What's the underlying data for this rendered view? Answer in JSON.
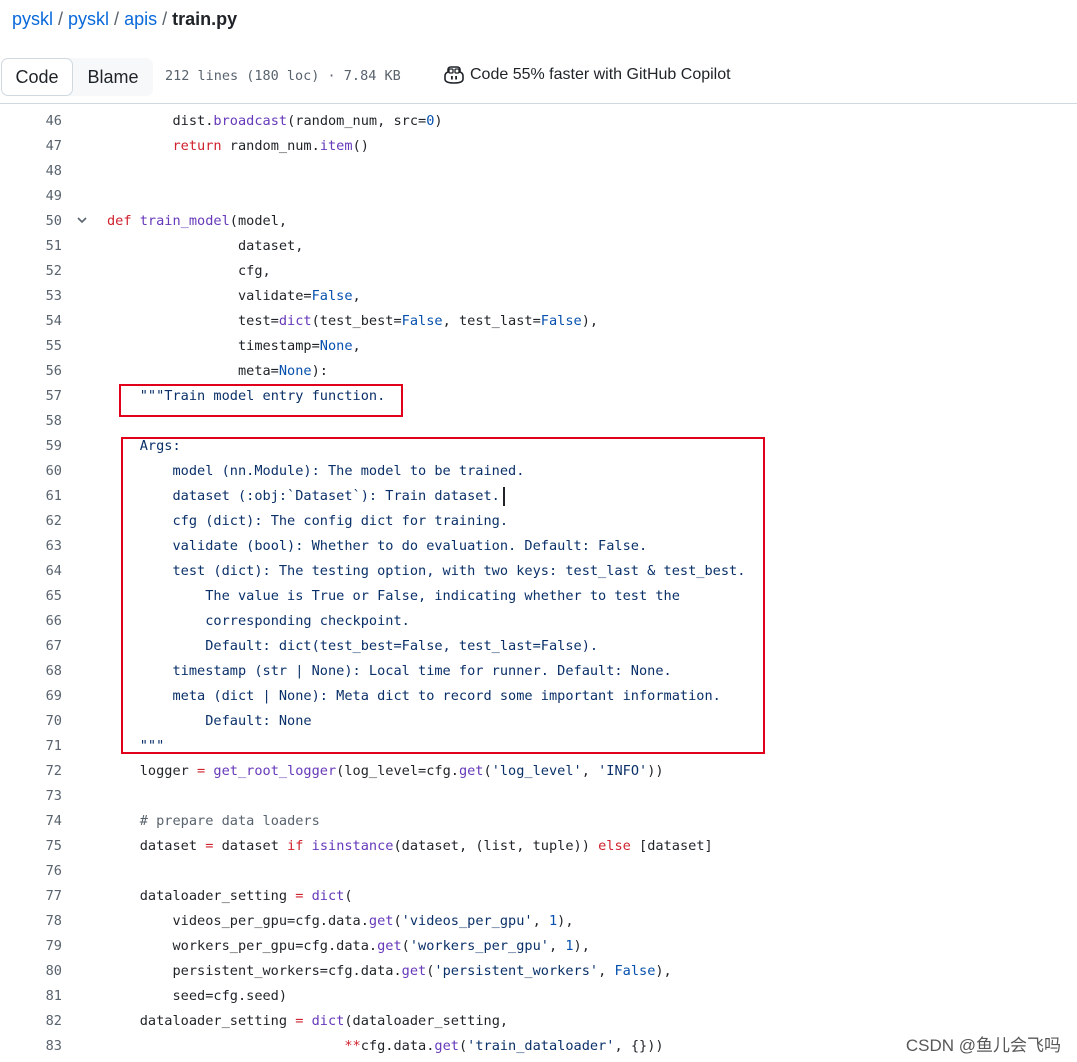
{
  "breadcrumb": {
    "repo": "pyskl",
    "dir1": "pyskl",
    "dir2": "apis",
    "file": "train.py",
    "separator": "/"
  },
  "toolbar": {
    "code_tab": "Code",
    "blame_tab": "Blame",
    "file_info": "212 lines (180 loc) · 7.84 KB",
    "copilot_text": "Code 55% faster with GitHub Copilot",
    "copilot_icon": "copilot-icon"
  },
  "code_lines": [
    {
      "n": "46",
      "t": [
        [
          "        dist.",
          ""
        ],
        [
          "broadcast",
          "fn"
        ],
        [
          "(random_num, src=",
          ""
        ],
        [
          "0",
          "bi"
        ],
        [
          ")",
          ""
        ]
      ]
    },
    {
      "n": "47",
      "t": [
        [
          "        ",
          ""
        ],
        [
          "return",
          "kw"
        ],
        [
          " random_num.",
          ""
        ],
        [
          "item",
          "fn"
        ],
        [
          "()",
          ""
        ]
      ]
    },
    {
      "n": "48",
      "t": []
    },
    {
      "n": "49",
      "t": []
    },
    {
      "n": "50",
      "t": [
        [
          "def",
          "kw"
        ],
        [
          " ",
          ""
        ],
        [
          "train_model",
          "fn"
        ],
        [
          "(model,",
          ""
        ]
      ],
      "fold": true
    },
    {
      "n": "51",
      "t": [
        [
          "                dataset,",
          ""
        ]
      ]
    },
    {
      "n": "52",
      "t": [
        [
          "                cfg,",
          ""
        ]
      ]
    },
    {
      "n": "53",
      "t": [
        [
          "                validate=",
          ""
        ],
        [
          "False",
          "bi"
        ],
        [
          ",",
          ""
        ]
      ]
    },
    {
      "n": "54",
      "t": [
        [
          "                test=",
          ""
        ],
        [
          "dict",
          "fn"
        ],
        [
          "(test_best=",
          ""
        ],
        [
          "False",
          "bi"
        ],
        [
          ", test_last=",
          ""
        ],
        [
          "False",
          "bi"
        ],
        [
          "),",
          ""
        ]
      ]
    },
    {
      "n": "55",
      "t": [
        [
          "                timestamp=",
          ""
        ],
        [
          "None",
          "bi"
        ],
        [
          ",",
          ""
        ]
      ]
    },
    {
      "n": "56",
      "t": [
        [
          "                meta=",
          ""
        ],
        [
          "None",
          "bi"
        ],
        [
          "):",
          ""
        ]
      ]
    },
    {
      "n": "57",
      "t": [
        [
          "    ",
          ""
        ],
        [
          "\"\"\"Train model entry function.",
          "str"
        ]
      ]
    },
    {
      "n": "58",
      "t": []
    },
    {
      "n": "59",
      "t": [
        [
          "    ",
          ""
        ],
        [
          "Args:",
          "str"
        ]
      ]
    },
    {
      "n": "60",
      "t": [
        [
          "        ",
          ""
        ],
        [
          "model (nn.Module): The model to be trained.",
          "str"
        ]
      ]
    },
    {
      "n": "61",
      "t": [
        [
          "        ",
          ""
        ],
        [
          "dataset (:obj:`Dataset`): Train dataset.",
          "str"
        ]
      ]
    },
    {
      "n": "62",
      "t": [
        [
          "        ",
          ""
        ],
        [
          "cfg (dict): The config dict for training.",
          "str"
        ]
      ]
    },
    {
      "n": "63",
      "t": [
        [
          "        ",
          ""
        ],
        [
          "validate (bool): Whether to do evaluation. Default: False.",
          "str"
        ]
      ]
    },
    {
      "n": "64",
      "t": [
        [
          "        ",
          ""
        ],
        [
          "test (dict): The testing option, with two keys: test_last & test_best.",
          "str"
        ]
      ]
    },
    {
      "n": "65",
      "t": [
        [
          "            ",
          ""
        ],
        [
          "The value is True or False, indicating whether to test the",
          "str"
        ]
      ]
    },
    {
      "n": "66",
      "t": [
        [
          "            ",
          ""
        ],
        [
          "corresponding checkpoint.",
          "str"
        ]
      ]
    },
    {
      "n": "67",
      "t": [
        [
          "            ",
          ""
        ],
        [
          "Default: dict(test_best=False, test_last=False).",
          "str"
        ]
      ]
    },
    {
      "n": "68",
      "t": [
        [
          "        ",
          ""
        ],
        [
          "timestamp (str | None): Local time for runner. Default: None.",
          "str"
        ]
      ]
    },
    {
      "n": "69",
      "t": [
        [
          "        ",
          ""
        ],
        [
          "meta (dict | None): Meta dict to record some important information.",
          "str"
        ]
      ]
    },
    {
      "n": "70",
      "t": [
        [
          "            ",
          ""
        ],
        [
          "Default: None",
          "str"
        ]
      ]
    },
    {
      "n": "71",
      "t": [
        [
          "    ",
          ""
        ],
        [
          "\"\"\"",
          "str"
        ]
      ]
    },
    {
      "n": "72",
      "t": [
        [
          "    logger ",
          ""
        ],
        [
          "=",
          "kw"
        ],
        [
          " ",
          ""
        ],
        [
          "get_root_logger",
          "fn"
        ],
        [
          "(log_level=cfg.",
          ""
        ],
        [
          "get",
          "fn"
        ],
        [
          "(",
          ""
        ],
        [
          "'log_level'",
          "str"
        ],
        [
          ", ",
          ""
        ],
        [
          "'INFO'",
          "str"
        ],
        [
          "))",
          ""
        ]
      ]
    },
    {
      "n": "73",
      "t": []
    },
    {
      "n": "74",
      "t": [
        [
          "    ",
          ""
        ],
        [
          "# prepare data loaders",
          "cm"
        ]
      ]
    },
    {
      "n": "75",
      "t": [
        [
          "    dataset ",
          ""
        ],
        [
          "=",
          "kw"
        ],
        [
          " dataset ",
          ""
        ],
        [
          "if",
          "kw"
        ],
        [
          " ",
          ""
        ],
        [
          "isinstance",
          "fn"
        ],
        [
          "(dataset, (list, tuple)) ",
          ""
        ],
        [
          "else",
          "kw"
        ],
        [
          " [dataset]",
          ""
        ]
      ]
    },
    {
      "n": "76",
      "t": []
    },
    {
      "n": "77",
      "t": [
        [
          "    dataloader_setting ",
          ""
        ],
        [
          "=",
          "kw"
        ],
        [
          " ",
          ""
        ],
        [
          "dict",
          "fn"
        ],
        [
          "(",
          ""
        ]
      ]
    },
    {
      "n": "78",
      "t": [
        [
          "        videos_per_gpu=cfg.data.",
          ""
        ],
        [
          "get",
          "fn"
        ],
        [
          "(",
          ""
        ],
        [
          "'videos_per_gpu'",
          "str"
        ],
        [
          ", ",
          ""
        ],
        [
          "1",
          "bi"
        ],
        [
          "),",
          ""
        ]
      ]
    },
    {
      "n": "79",
      "t": [
        [
          "        workers_per_gpu=cfg.data.",
          ""
        ],
        [
          "get",
          "fn"
        ],
        [
          "(",
          ""
        ],
        [
          "'workers_per_gpu'",
          "str"
        ],
        [
          ", ",
          ""
        ],
        [
          "1",
          "bi"
        ],
        [
          "),",
          ""
        ]
      ]
    },
    {
      "n": "80",
      "t": [
        [
          "        persistent_workers=cfg.data.",
          ""
        ],
        [
          "get",
          "fn"
        ],
        [
          "(",
          ""
        ],
        [
          "'persistent_workers'",
          "str"
        ],
        [
          ", ",
          ""
        ],
        [
          "False",
          "bi"
        ],
        [
          "),",
          ""
        ]
      ]
    },
    {
      "n": "81",
      "t": [
        [
          "        seed=cfg.seed)",
          ""
        ]
      ]
    },
    {
      "n": "82",
      "t": [
        [
          "    dataloader_setting ",
          ""
        ],
        [
          "=",
          "kw"
        ],
        [
          " ",
          ""
        ],
        [
          "dict",
          "fn"
        ],
        [
          "(dataloader_setting,",
          ""
        ]
      ]
    },
    {
      "n": "83",
      "t": [
        [
          "                             ",
          ""
        ],
        [
          "**",
          "kw"
        ],
        [
          "cfg.data.",
          ""
        ],
        [
          "get",
          "fn"
        ],
        [
          "(",
          ""
        ],
        [
          "'train_dataloader'",
          "str"
        ],
        [
          ", {}))",
          ""
        ]
      ]
    }
  ],
  "watermark": "CSDN @鱼儿会飞吗"
}
